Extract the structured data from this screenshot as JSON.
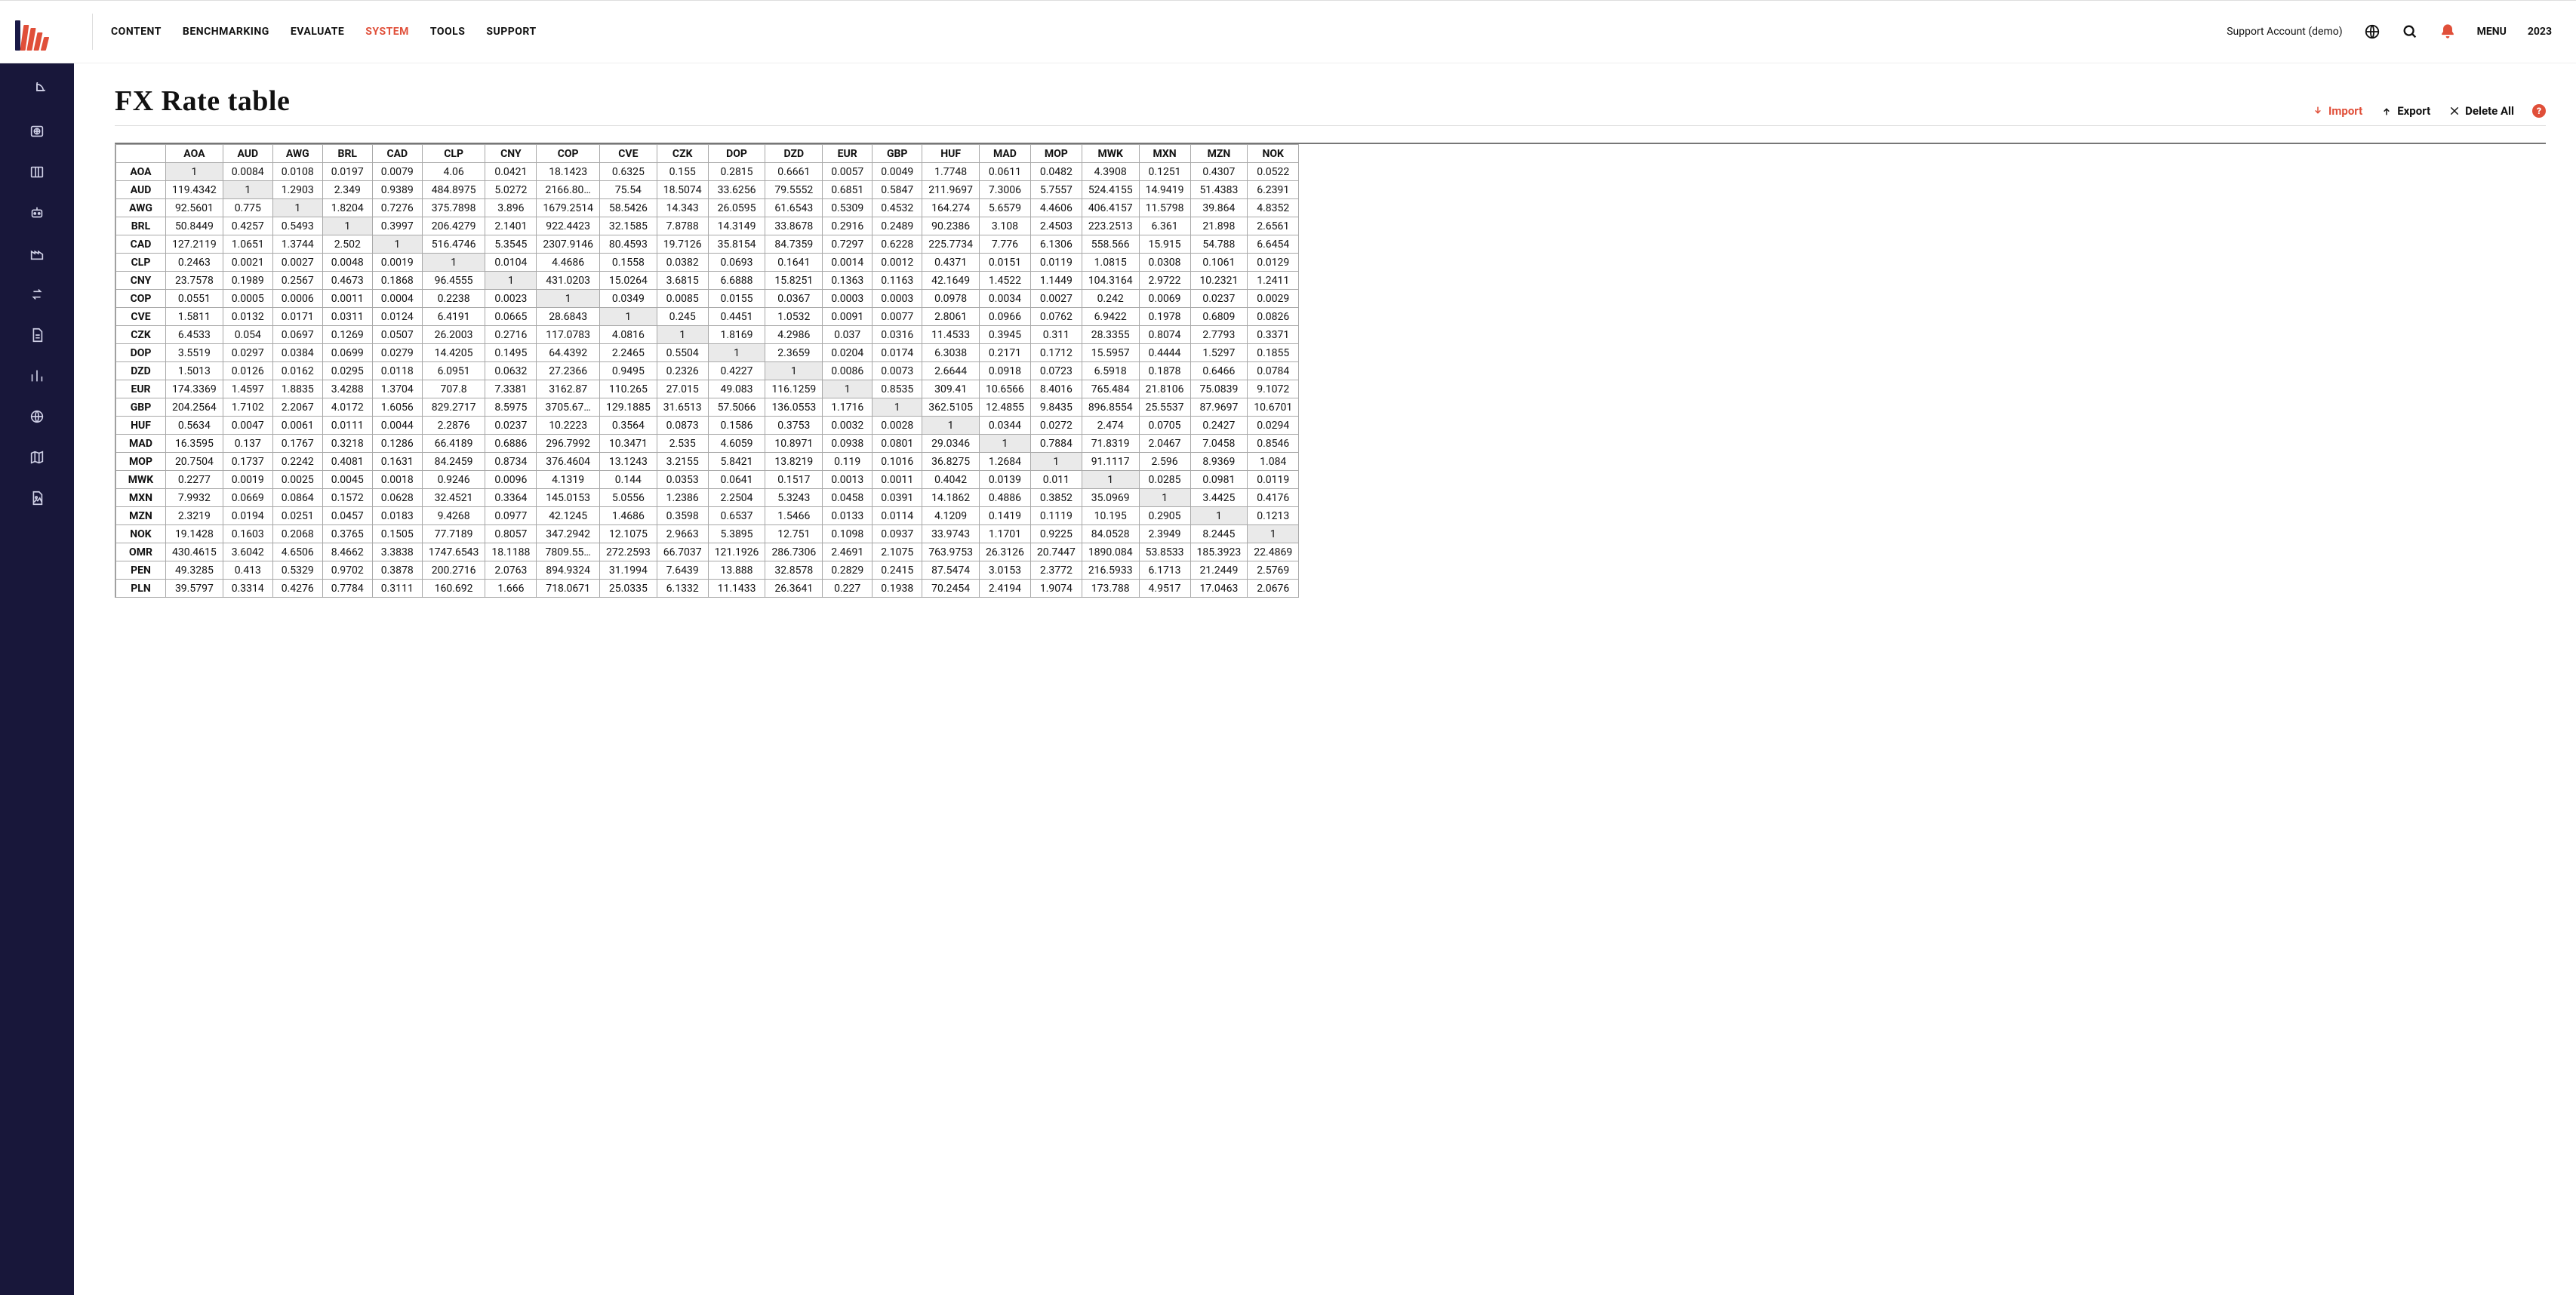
{
  "header": {
    "nav": [
      {
        "key": "content",
        "label": "CONTENT",
        "active": false
      },
      {
        "key": "benchmarking",
        "label": "BENCHMARKING",
        "active": false
      },
      {
        "key": "evaluate",
        "label": "EVALUATE",
        "active": false
      },
      {
        "key": "system",
        "label": "SYSTEM",
        "active": true
      },
      {
        "key": "tools",
        "label": "TOOLS",
        "active": false
      },
      {
        "key": "support",
        "label": "SUPPORT",
        "active": false
      }
    ],
    "account_label": "Support Account (demo)",
    "menu_label": "MENU",
    "year_label": "2023"
  },
  "sidebar": {
    "items": [
      {
        "name": "pie-chart-icon"
      },
      {
        "name": "globe-box-icon"
      },
      {
        "name": "columns-icon"
      },
      {
        "name": "robot-icon"
      },
      {
        "name": "factory-icon"
      },
      {
        "name": "swap-icon"
      },
      {
        "name": "document-icon"
      },
      {
        "name": "bar-chart-icon"
      },
      {
        "name": "globe-icon"
      },
      {
        "name": "map-icon"
      },
      {
        "name": "file-image-icon"
      }
    ]
  },
  "page": {
    "title": "FX Rate table",
    "actions": {
      "import": "Import",
      "export": "Export",
      "delete_all": "Delete All"
    }
  },
  "table": {
    "columns": [
      "AOA",
      "AUD",
      "AWG",
      "BRL",
      "CAD",
      "CLP",
      "CNY",
      "COP",
      "CVE",
      "CZK",
      "DOP",
      "DZD",
      "EUR",
      "GBP",
      "HUF",
      "MAD",
      "MOP",
      "MWK",
      "MXN",
      "MZN",
      "NOK"
    ],
    "rows": [
      {
        "code": "AOA",
        "cells": [
          "1",
          "0.0084",
          "0.0108",
          "0.0197",
          "0.0079",
          "4.06",
          "0.0421",
          "18.1423",
          "0.6325",
          "0.155",
          "0.2815",
          "0.6661",
          "0.0057",
          "0.0049",
          "1.7748",
          "0.0611",
          "0.0482",
          "4.3908",
          "0.1251",
          "0.4307",
          "0.0522"
        ]
      },
      {
        "code": "AUD",
        "cells": [
          "119.4342",
          "1",
          "1.2903",
          "2.349",
          "0.9389",
          "484.8975",
          "5.0272",
          "2166.80…",
          "75.54",
          "18.5074",
          "33.6256",
          "79.5552",
          "0.6851",
          "0.5847",
          "211.9697",
          "7.3006",
          "5.7557",
          "524.4155",
          "14.9419",
          "51.4383",
          "6.2391"
        ]
      },
      {
        "code": "AWG",
        "cells": [
          "92.5601",
          "0.775",
          "1",
          "1.8204",
          "0.7276",
          "375.7898",
          "3.896",
          "1679.2514",
          "58.5426",
          "14.343",
          "26.0595",
          "61.6543",
          "0.5309",
          "0.4532",
          "164.274",
          "5.6579",
          "4.4606",
          "406.4157",
          "11.5798",
          "39.864",
          "4.8352"
        ]
      },
      {
        "code": "BRL",
        "cells": [
          "50.8449",
          "0.4257",
          "0.5493",
          "1",
          "0.3997",
          "206.4279",
          "2.1401",
          "922.4423",
          "32.1585",
          "7.8788",
          "14.3149",
          "33.8678",
          "0.2916",
          "0.2489",
          "90.2386",
          "3.108",
          "2.4503",
          "223.2513",
          "6.361",
          "21.898",
          "2.6561"
        ]
      },
      {
        "code": "CAD",
        "cells": [
          "127.2119",
          "1.0651",
          "1.3744",
          "2.502",
          "1",
          "516.4746",
          "5.3545",
          "2307.9146",
          "80.4593",
          "19.7126",
          "35.8154",
          "84.7359",
          "0.7297",
          "0.6228",
          "225.7734",
          "7.776",
          "6.1306",
          "558.566",
          "15.915",
          "54.788",
          "6.6454"
        ]
      },
      {
        "code": "CLP",
        "cells": [
          "0.2463",
          "0.0021",
          "0.0027",
          "0.0048",
          "0.0019",
          "1",
          "0.0104",
          "4.4686",
          "0.1558",
          "0.0382",
          "0.0693",
          "0.1641",
          "0.0014",
          "0.0012",
          "0.4371",
          "0.0151",
          "0.0119",
          "1.0815",
          "0.0308",
          "0.1061",
          "0.0129"
        ]
      },
      {
        "code": "CNY",
        "cells": [
          "23.7578",
          "0.1989",
          "0.2567",
          "0.4673",
          "0.1868",
          "96.4555",
          "1",
          "431.0203",
          "15.0264",
          "3.6815",
          "6.6888",
          "15.8251",
          "0.1363",
          "0.1163",
          "42.1649",
          "1.4522",
          "1.1449",
          "104.3164",
          "2.9722",
          "10.2321",
          "1.2411"
        ]
      },
      {
        "code": "COP",
        "cells": [
          "0.0551",
          "0.0005",
          "0.0006",
          "0.0011",
          "0.0004",
          "0.2238",
          "0.0023",
          "1",
          "0.0349",
          "0.0085",
          "0.0155",
          "0.0367",
          "0.0003",
          "0.0003",
          "0.0978",
          "0.0034",
          "0.0027",
          "0.242",
          "0.0069",
          "0.0237",
          "0.0029"
        ]
      },
      {
        "code": "CVE",
        "cells": [
          "1.5811",
          "0.0132",
          "0.0171",
          "0.0311",
          "0.0124",
          "6.4191",
          "0.0665",
          "28.6843",
          "1",
          "0.245",
          "0.4451",
          "1.0532",
          "0.0091",
          "0.0077",
          "2.8061",
          "0.0966",
          "0.0762",
          "6.9422",
          "0.1978",
          "0.6809",
          "0.0826"
        ]
      },
      {
        "code": "CZK",
        "cells": [
          "6.4533",
          "0.054",
          "0.0697",
          "0.1269",
          "0.0507",
          "26.2003",
          "0.2716",
          "117.0783",
          "4.0816",
          "1",
          "1.8169",
          "4.2986",
          "0.037",
          "0.0316",
          "11.4533",
          "0.3945",
          "0.311",
          "28.3355",
          "0.8074",
          "2.7793",
          "0.3371"
        ]
      },
      {
        "code": "DOP",
        "cells": [
          "3.5519",
          "0.0297",
          "0.0384",
          "0.0699",
          "0.0279",
          "14.4205",
          "0.1495",
          "64.4392",
          "2.2465",
          "0.5504",
          "1",
          "2.3659",
          "0.0204",
          "0.0174",
          "6.3038",
          "0.2171",
          "0.1712",
          "15.5957",
          "0.4444",
          "1.5297",
          "0.1855"
        ]
      },
      {
        "code": "DZD",
        "cells": [
          "1.5013",
          "0.0126",
          "0.0162",
          "0.0295",
          "0.0118",
          "6.0951",
          "0.0632",
          "27.2366",
          "0.9495",
          "0.2326",
          "0.4227",
          "1",
          "0.0086",
          "0.0073",
          "2.6644",
          "0.0918",
          "0.0723",
          "6.5918",
          "0.1878",
          "0.6466",
          "0.0784"
        ]
      },
      {
        "code": "EUR",
        "cells": [
          "174.3369",
          "1.4597",
          "1.8835",
          "3.4288",
          "1.3704",
          "707.8",
          "7.3381",
          "3162.87",
          "110.265",
          "27.015",
          "49.083",
          "116.1259",
          "1",
          "0.8535",
          "309.41",
          "10.6566",
          "8.4016",
          "765.484",
          "21.8106",
          "75.0839",
          "9.1072"
        ]
      },
      {
        "code": "GBP",
        "cells": [
          "204.2564",
          "1.7102",
          "2.2067",
          "4.0172",
          "1.6056",
          "829.2717",
          "8.5975",
          "3705.67…",
          "129.1885",
          "31.6513",
          "57.5066",
          "136.0553",
          "1.1716",
          "1",
          "362.5105",
          "12.4855",
          "9.8435",
          "896.8554",
          "25.5537",
          "87.9697",
          "10.6701"
        ]
      },
      {
        "code": "HUF",
        "cells": [
          "0.5634",
          "0.0047",
          "0.0061",
          "0.0111",
          "0.0044",
          "2.2876",
          "0.0237",
          "10.2223",
          "0.3564",
          "0.0873",
          "0.1586",
          "0.3753",
          "0.0032",
          "0.0028",
          "1",
          "0.0344",
          "0.0272",
          "2.474",
          "0.0705",
          "0.2427",
          "0.0294"
        ]
      },
      {
        "code": "MAD",
        "cells": [
          "16.3595",
          "0.137",
          "0.1767",
          "0.3218",
          "0.1286",
          "66.4189",
          "0.6886",
          "296.7992",
          "10.3471",
          "2.535",
          "4.6059",
          "10.8971",
          "0.0938",
          "0.0801",
          "29.0346",
          "1",
          "0.7884",
          "71.8319",
          "2.0467",
          "7.0458",
          "0.8546"
        ]
      },
      {
        "code": "MOP",
        "cells": [
          "20.7504",
          "0.1737",
          "0.2242",
          "0.4081",
          "0.1631",
          "84.2459",
          "0.8734",
          "376.4604",
          "13.1243",
          "3.2155",
          "5.8421",
          "13.8219",
          "0.119",
          "0.1016",
          "36.8275",
          "1.2684",
          "1",
          "91.1117",
          "2.596",
          "8.9369",
          "1.084"
        ]
      },
      {
        "code": "MWK",
        "cells": [
          "0.2277",
          "0.0019",
          "0.0025",
          "0.0045",
          "0.0018",
          "0.9246",
          "0.0096",
          "4.1319",
          "0.144",
          "0.0353",
          "0.0641",
          "0.1517",
          "0.0013",
          "0.0011",
          "0.4042",
          "0.0139",
          "0.011",
          "1",
          "0.0285",
          "0.0981",
          "0.0119"
        ]
      },
      {
        "code": "MXN",
        "cells": [
          "7.9932",
          "0.0669",
          "0.0864",
          "0.1572",
          "0.0628",
          "32.4521",
          "0.3364",
          "145.0153",
          "5.0556",
          "1.2386",
          "2.2504",
          "5.3243",
          "0.0458",
          "0.0391",
          "14.1862",
          "0.4886",
          "0.3852",
          "35.0969",
          "1",
          "3.4425",
          "0.4176"
        ]
      },
      {
        "code": "MZN",
        "cells": [
          "2.3219",
          "0.0194",
          "0.0251",
          "0.0457",
          "0.0183",
          "9.4268",
          "0.0977",
          "42.1245",
          "1.4686",
          "0.3598",
          "0.6537",
          "1.5466",
          "0.0133",
          "0.0114",
          "4.1209",
          "0.1419",
          "0.1119",
          "10.195",
          "0.2905",
          "1",
          "0.1213"
        ]
      },
      {
        "code": "NOK",
        "cells": [
          "19.1428",
          "0.1603",
          "0.2068",
          "0.3765",
          "0.1505",
          "77.7189",
          "0.8057",
          "347.2942",
          "12.1075",
          "2.9663",
          "5.3895",
          "12.751",
          "0.1098",
          "0.0937",
          "33.9743",
          "1.1701",
          "0.9225",
          "84.0528",
          "2.3949",
          "8.2445",
          "1"
        ]
      },
      {
        "code": "OMR",
        "cells": [
          "430.4615",
          "3.6042",
          "4.6506",
          "8.4662",
          "3.3838",
          "1747.6543",
          "18.1188",
          "7809.55…",
          "272.2593",
          "66.7037",
          "121.1926",
          "286.7306",
          "2.4691",
          "2.1075",
          "763.9753",
          "26.3126",
          "20.7447",
          "1890.084",
          "53.8533",
          "185.3923",
          "22.4869"
        ]
      },
      {
        "code": "PEN",
        "cells": [
          "49.3285",
          "0.413",
          "0.5329",
          "0.9702",
          "0.3878",
          "200.2716",
          "2.0763",
          "894.9324",
          "31.1994",
          "7.6439",
          "13.888",
          "32.8578",
          "0.2829",
          "0.2415",
          "87.5474",
          "3.0153",
          "2.3772",
          "216.5933",
          "6.1713",
          "21.2449",
          "2.5769"
        ]
      },
      {
        "code": "PLN",
        "cells": [
          "39.5797",
          "0.3314",
          "0.4276",
          "0.7784",
          "0.3111",
          "160.692",
          "1.666",
          "718.0671",
          "25.0335",
          "6.1332",
          "11.1433",
          "26.3641",
          "0.227",
          "0.1938",
          "70.2454",
          "2.4194",
          "1.9074",
          "173.788",
          "4.9517",
          "17.0463",
          "2.0676"
        ]
      }
    ]
  }
}
